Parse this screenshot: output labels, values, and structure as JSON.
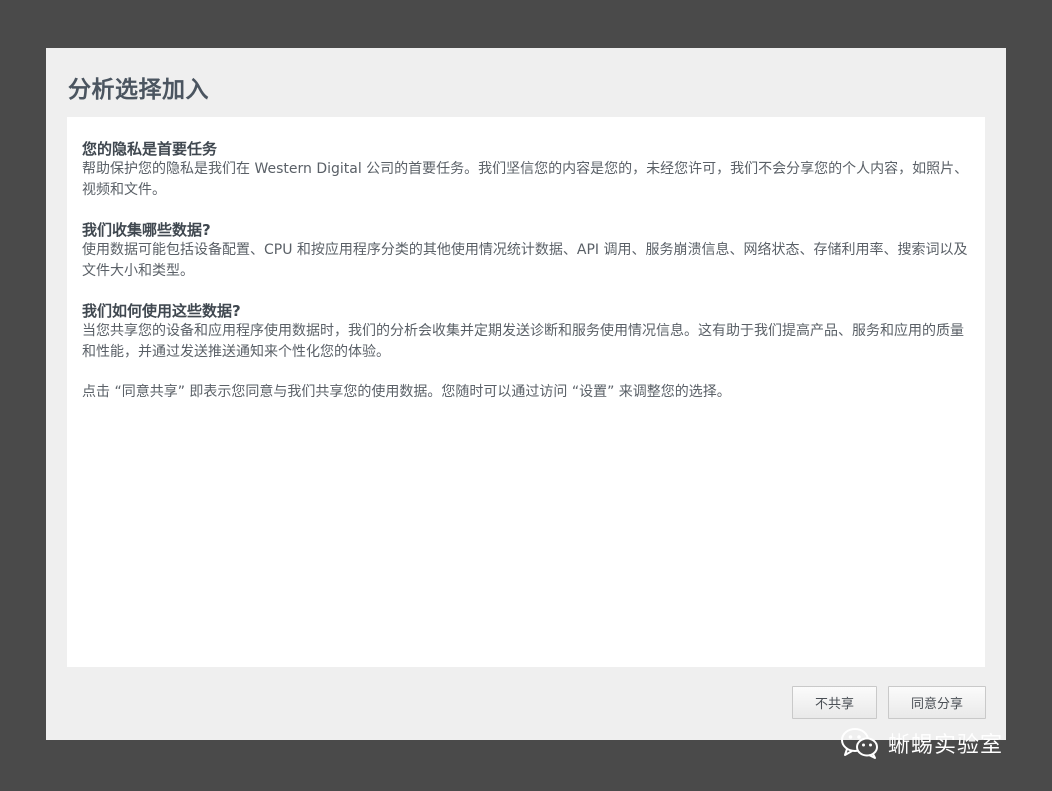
{
  "dialog": {
    "title": "分析选择加入",
    "sections": [
      {
        "heading": "您的隐私是首要任务",
        "body": "帮助保护您的隐私是我们在 Western Digital 公司的首要任务。我们坚信您的内容是您的，未经您许可，我们不会分享您的个人内容，如照片、视频和文件。"
      },
      {
        "heading": "我们收集哪些数据?",
        "body": "使用数据可能包括设备配置、CPU 和按应用程序分类的其他使用情况统计数据、API 调用、服务崩溃信息、网络状态、存储利用率、搜索词以及文件大小和类型。"
      },
      {
        "heading": "我们如何使用这些数据?",
        "body": "当您共享您的设备和应用程序使用数据时，我们的分析会收集并定期发送诊断和服务使用情况信息。这有助于我们提高产品、服务和应用的质量和性能，并通过发送推送通知来个性化您的体验。"
      }
    ],
    "consent_note": "点击 “同意共享” 即表示您同意与我们共享您的使用数据。您随时可以通过访问 “设置” 来调整您的选择。",
    "buttons": {
      "decline_label": "不共享",
      "accept_label": "同意分享"
    }
  },
  "watermark": {
    "icon": "wechat-icon",
    "text": "蜥蜴实验室"
  }
}
